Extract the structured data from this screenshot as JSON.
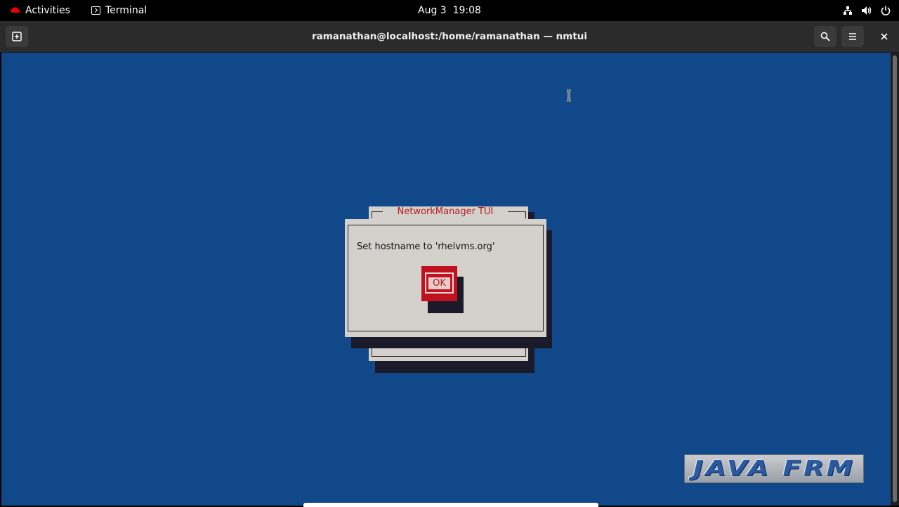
{
  "topbar": {
    "activities_label": "Activities",
    "app_label": "Terminal",
    "clock": "Aug 3  19:08",
    "status_icons": [
      "network-icon",
      "volume-icon",
      "power-icon"
    ]
  },
  "window": {
    "title": "ramanathan@localhost:/home/ramanathan — nmtui",
    "buttons": [
      "new-tab-icon",
      "search-icon",
      "hamburger-menu-icon",
      "close-icon"
    ]
  },
  "dialog": {
    "title": "NetworkManager TUI",
    "message": "Set hostname to 'rhelvms.org'",
    "ok_label": "OK"
  },
  "watermark": {
    "text": "JAVA FRM"
  },
  "colors": {
    "terminal_bg": "#11488a",
    "dialog_bg": "#d4d0cc",
    "accent_red": "#c1111e",
    "title_red": "#b31b1b"
  }
}
